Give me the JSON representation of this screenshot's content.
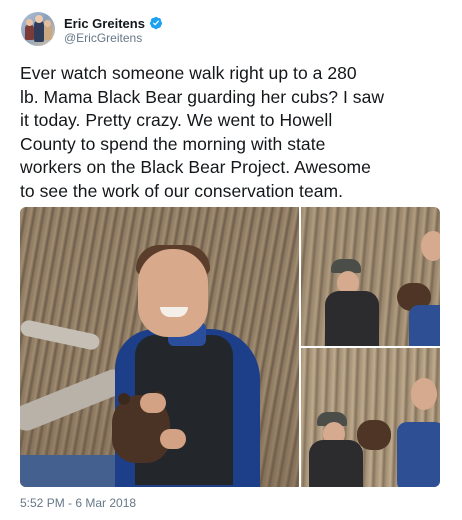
{
  "author": {
    "display_name": "Eric Greitens",
    "handle": "@EricGreitens",
    "verified_icon": "verified-badge-icon",
    "verified_color": "#1da1f2"
  },
  "tweet": {
    "text_lines": [
      "Ever watch someone walk right up to a 280",
      "lb. Mama Black Bear guarding her cubs? I saw",
      "it today. Pretty crazy. We went to Howell",
      "County to spend the morning with state",
      "workers on the Black Bear Project. Awesome",
      "to see the work of our conservation team."
    ],
    "timestamp": "5:52 PM - 6 Mar 2018"
  },
  "colors": {
    "text": "#14171a",
    "secondary": "#657786",
    "background": "#ffffff"
  }
}
